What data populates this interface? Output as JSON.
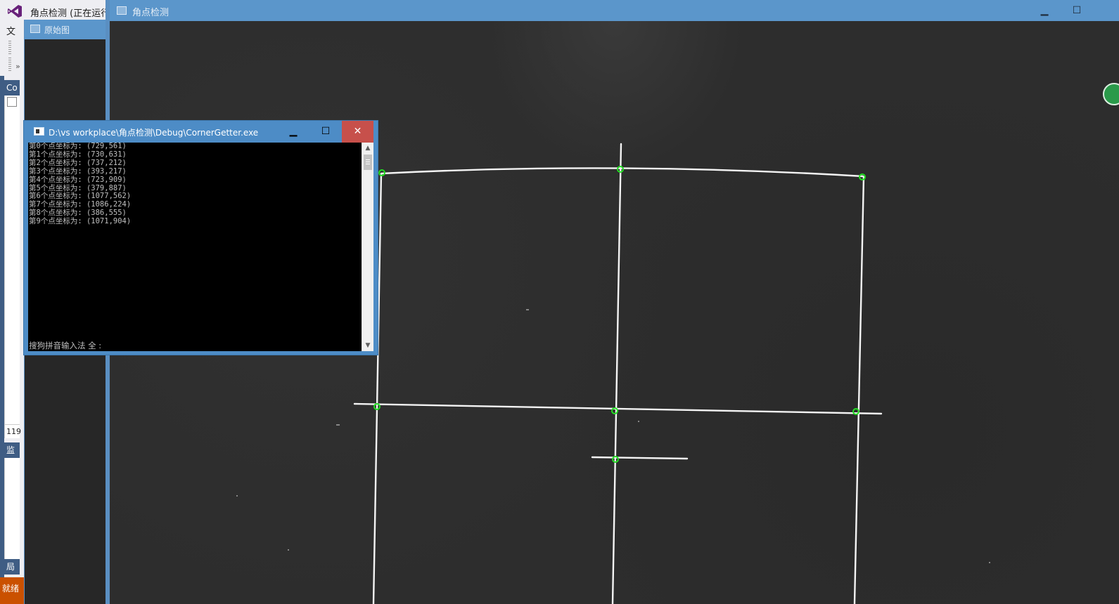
{
  "vs": {
    "title": "角点检测 (正在运行",
    "menu_label": "文",
    "panel_label": "Co",
    "line_number": "119",
    "monitor_label": "监",
    "locals_label": "局",
    "status_label": "就绪"
  },
  "original_window": {
    "title": "原始图"
  },
  "main_window": {
    "title": "角点检测",
    "min_glyph": "▁",
    "max_glyph": "☐"
  },
  "console": {
    "title": "D:\\vs workplace\\角点检测\\Debug\\CornerGetter.exe",
    "min_glyph": "▁",
    "max_glyph": "☐",
    "close_glyph": "✕",
    "lines": [
      "第0个点坐标为: (729,561)",
      "第1个点坐标为: (730,631)",
      "第2个点坐标为: (737,212)",
      "第3个点坐标为: (393,217)",
      "第4个点坐标为: (723,909)",
      "第5个点坐标为: (379,887)",
      "第6个点坐标为: (1077,562)",
      "第7个点坐标为: (1086,224)",
      "第8个点坐标为: (386,555)",
      "第9个点坐标为: (1071,904)"
    ],
    "ime_status": "搜狗拼音输入法 全 :",
    "scroll_up_glyph": "▲",
    "scroll_down_glyph": "▼"
  },
  "colors": {
    "line_color": "#f4f4f4",
    "corner_marker_color": "#22e022",
    "title_bar_blue": "#5b96cb",
    "close_red": "#c7504b"
  }
}
